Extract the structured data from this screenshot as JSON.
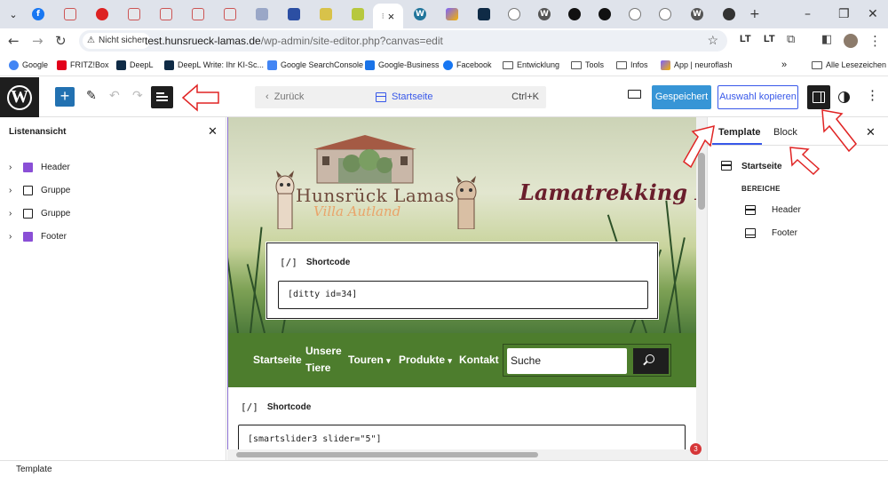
{
  "browser": {
    "active_tab_close": "×",
    "new_tab": "+",
    "address": {
      "security_label": "Nicht sicher",
      "url_host": "test.hunsrueck-lamas.de",
      "url_path": "/wp-admin/site-editor.php?canvas=edit"
    },
    "extensions": [
      "LT",
      "LT"
    ],
    "bookmarks": [
      {
        "label": "Google",
        "color": "#4285f4"
      },
      {
        "label": "FRITZ!Box",
        "color": "#e2001a"
      },
      {
        "label": "DeepL",
        "color": "#0f2b46"
      },
      {
        "label": "DeepL Write: Ihr KI-Sc...",
        "color": "#0f2b46"
      },
      {
        "label": "Google SearchConsole",
        "color": "#4285f4"
      },
      {
        "label": "Google-Business",
        "color": "#1a73e8"
      },
      {
        "label": "Facebook",
        "color": "#1877f2"
      },
      {
        "label": "Entwicklung",
        "color": "folder"
      },
      {
        "label": "Tools",
        "color": "folder"
      },
      {
        "label": "Infos",
        "color": "folder"
      },
      {
        "label": "App | neuroflash",
        "color": "#7b61ff"
      }
    ],
    "bookmarks_overflow": "»",
    "all_bookmarks": "Alle Lesezeichen"
  },
  "editor": {
    "header": {
      "back_label": "Zurück",
      "doc_title": "Startseite",
      "shortcut": "Ctrl+K",
      "save_label": "Gespeichert",
      "copy_label": "Auswahl kopieren"
    },
    "list_view": {
      "title": "Listenansicht",
      "items": [
        {
          "label": "Header",
          "color": "#8a4fd6"
        },
        {
          "label": "Gruppe",
          "color": "#1e1e1e"
        },
        {
          "label": "Gruppe",
          "color": "#1e1e1e"
        },
        {
          "label": "Footer",
          "color": "#8a4fd6"
        }
      ]
    },
    "canvas": {
      "logo_title": "Hunsrück Lamas",
      "logo_subtitle": "Villa Autland",
      "tagline": "Lamatrekking La",
      "shortcode_1": {
        "label": "Shortcode",
        "icon": "[/]",
        "value": "[ditty id=34]"
      },
      "nav": [
        {
          "label": "Startseite"
        },
        {
          "label": "Unsere Tiere"
        },
        {
          "label": "Touren"
        },
        {
          "label": "Produkte"
        },
        {
          "label": "Kontakt"
        }
      ],
      "search_value": "Suche",
      "shortcode_2": {
        "label": "Shortcode",
        "icon": "[/]",
        "value": "[smartslider3 slider=\"5\"]"
      },
      "notification_count": "3"
    },
    "sidebar": {
      "tabs": [
        "Template",
        "Block"
      ],
      "template_name": "Startseite",
      "areas_heading": "BEREICHE",
      "areas": [
        "Header",
        "Footer"
      ]
    },
    "status_bar": "Template"
  },
  "colors": {
    "wp_blue": "#3858e9",
    "save_blue": "#3795d6",
    "nav_green": "#4d7d2d",
    "annotation_red": "#e02424"
  }
}
